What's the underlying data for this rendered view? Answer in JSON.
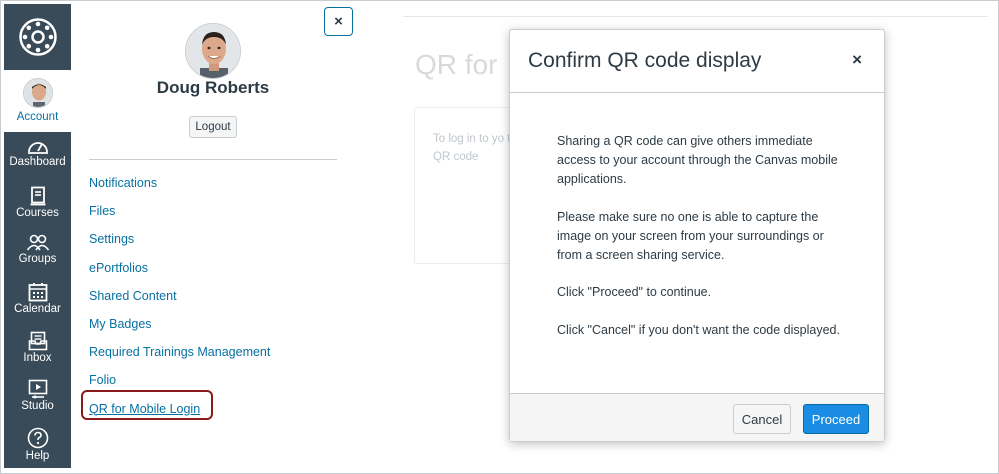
{
  "global_nav": {
    "logo_icon": "canvas-logo-icon",
    "account": {
      "label": "Account",
      "icon": "avatar"
    },
    "items": [
      {
        "label": "Dashboard",
        "icon": "dashboard-icon"
      },
      {
        "label": "Courses",
        "icon": "courses-icon"
      },
      {
        "label": "Groups",
        "icon": "groups-icon"
      },
      {
        "label": "Calendar",
        "icon": "calendar-icon"
      },
      {
        "label": "Inbox",
        "icon": "inbox-icon"
      },
      {
        "label": "Studio",
        "icon": "studio-icon"
      },
      {
        "label": "Help",
        "icon": "help-icon"
      }
    ]
  },
  "tray": {
    "close_label": "×",
    "user_name": "Doug Roberts",
    "logout_label": "Logout",
    "links": [
      "Notifications",
      "Files",
      "Settings",
      "ePortfolios",
      "Shared Content",
      "My Badges",
      "Required Trainings Management",
      "Folio",
      "QR for Mobile Login"
    ]
  },
  "background_page": {
    "title": "QR for",
    "text": "To log in to yo this QR code"
  },
  "modal": {
    "title": "Confirm QR code display",
    "close_label": "×",
    "paragraphs": [
      "Sharing a QR code can give others immediate access to your account through the Canvas mobile applications.",
      "Please make sure no one is able to capture the image on your screen from your surroundings or from a screen sharing service.",
      "Click \"Proceed\" to continue.",
      "Click \"Cancel\" if you don't want the code displayed."
    ],
    "cancel_label": "Cancel",
    "proceed_label": "Proceed"
  },
  "colors": {
    "nav_bg": "#394b58",
    "link": "#0770a3",
    "primary_button": "#1b8ce3",
    "highlight": "#8b1a1a"
  }
}
